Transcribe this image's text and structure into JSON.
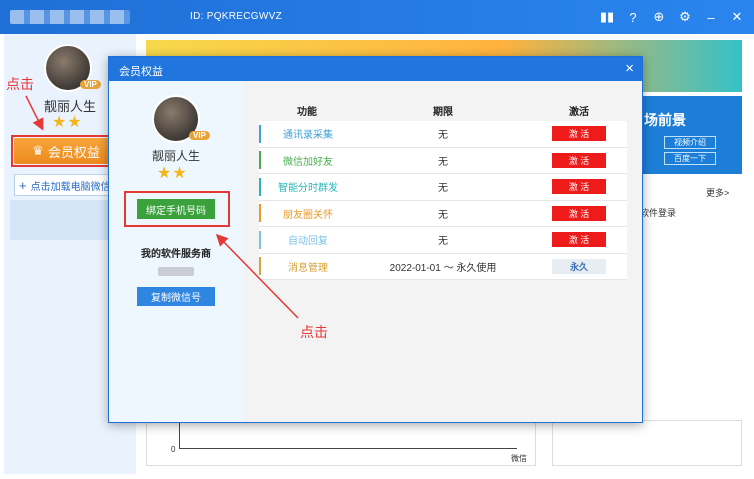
{
  "window": {
    "id_text": "ID: PQKRECGWVZ"
  },
  "titlebar_icons": [
    "gift-icon",
    "help-icon",
    "upload-icon",
    "settings-icon",
    "minimize-icon",
    "close-icon"
  ],
  "sidebar": {
    "user_name": "靓丽人生",
    "vip_badge": "VIP",
    "stars": "★★",
    "member_button": "会员权益",
    "load_link": "点击加载电脑微信"
  },
  "annotations": {
    "click_left": "点击",
    "click_bottom": "点击"
  },
  "background": {
    "banner_title": "场前景",
    "video_btn": "视频介绍",
    "baidu_btn": "百度一下",
    "more": "更多>",
    "list_item": "软件登录",
    "chart_ylabel": "0",
    "chart_xlabel": "微信"
  },
  "modal": {
    "title": "会员权益",
    "close": "×",
    "user_name": "靓丽人生",
    "vip_badge": "VIP",
    "stars": "★★",
    "bind_phone_button": "绑定手机号码",
    "service_title": "我的软件服务商",
    "copy_wechat_button": "复制微信号",
    "table": {
      "headers": [
        "功能",
        "期限",
        "激活"
      ],
      "rows": [
        {
          "name": "通讯录采集",
          "term": "无",
          "action": "激 活",
          "color": "#3fa0d8"
        },
        {
          "name": "微信加好友",
          "term": "无",
          "action": "激 活",
          "color": "#46b04a"
        },
        {
          "name": "智能分时群发",
          "term": "无",
          "action": "激 活",
          "color": "#2ab6b6"
        },
        {
          "name": "朋友圈关怀",
          "term": "无",
          "action": "激 活",
          "color": "#e99a2a"
        },
        {
          "name": "自动回复",
          "term": "无",
          "action": "激 活",
          "color": "#7cc3e8"
        },
        {
          "name": "消息管理",
          "term": "2022-01-01 ～ 永久使用",
          "action": "永久",
          "color": "#d8a23a"
        }
      ]
    }
  },
  "colors": {
    "primary": "#2076dc",
    "activate": "#ee1b1b",
    "accent_orange": "#ee8a1e",
    "annotation_red": "#e53935"
  }
}
